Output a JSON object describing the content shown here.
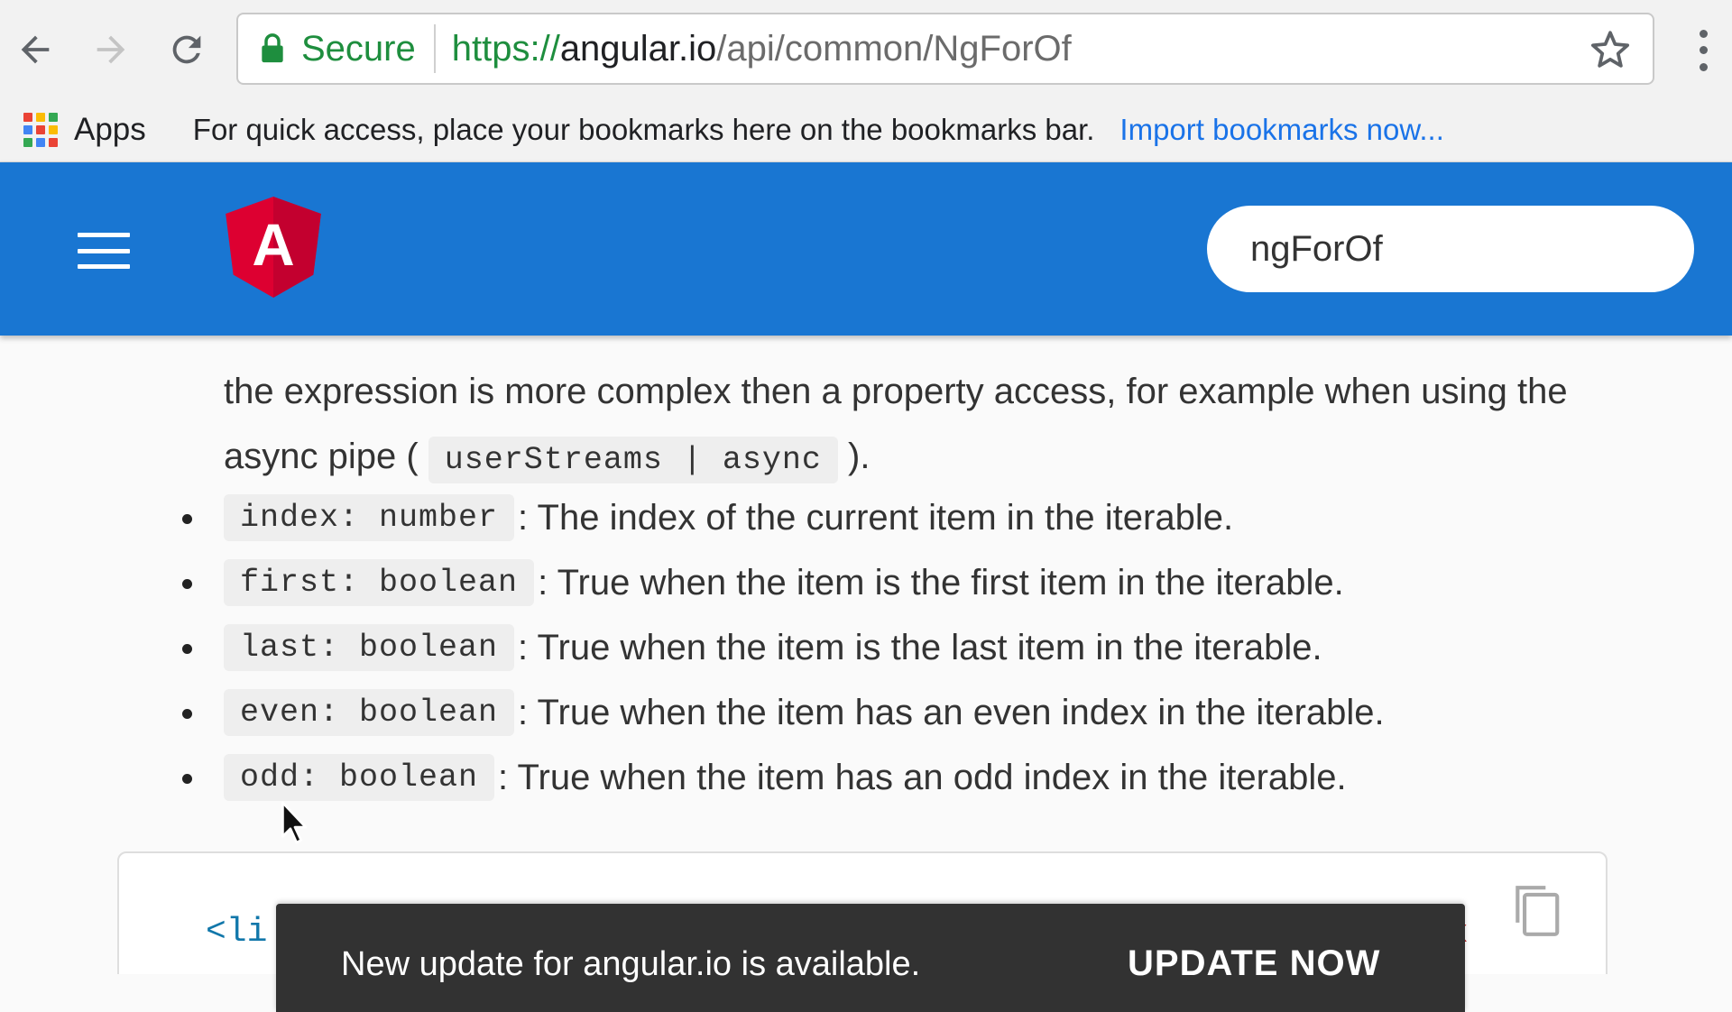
{
  "browser": {
    "secure_label": "Secure",
    "url": {
      "scheme": "https://",
      "host": "angular.io",
      "path": "/api/common/NgForOf"
    },
    "accent_color": "#1e8e3e"
  },
  "bookmarks_bar": {
    "apps_label": "Apps",
    "hint": "For quick access, place your bookmarks here on the bookmarks bar.",
    "import_link": "Import bookmarks now..."
  },
  "header": {
    "brand_color": "#1976d2",
    "logo_letter": "A",
    "search_value": "ngForOf"
  },
  "content": {
    "paragraph": {
      "text_before": "the expression is more complex then a property access, for example when using the async pipe (",
      "code": "userStreams | async",
      "text_after": ")."
    },
    "bullets": [
      {
        "code": "index: number",
        "text": ": The index of the current item in the iterable."
      },
      {
        "code": "first: boolean",
        "text": ": True when the item is the first item in the iterable."
      },
      {
        "code": "last: boolean",
        "text": ": True when the item is the last item in the iterable."
      },
      {
        "code": "even: boolean",
        "text": ": True when the item has an even index in the iterable."
      },
      {
        "code": "odd: boolean",
        "text": ": True when the item has an odd index in the iterable."
      }
    ],
    "code_example": {
      "visible_code": "<li",
      "trailing_char": "x"
    }
  },
  "snackbar": {
    "message": "New update for angular.io is available.",
    "action": "UPDATE NOW"
  }
}
